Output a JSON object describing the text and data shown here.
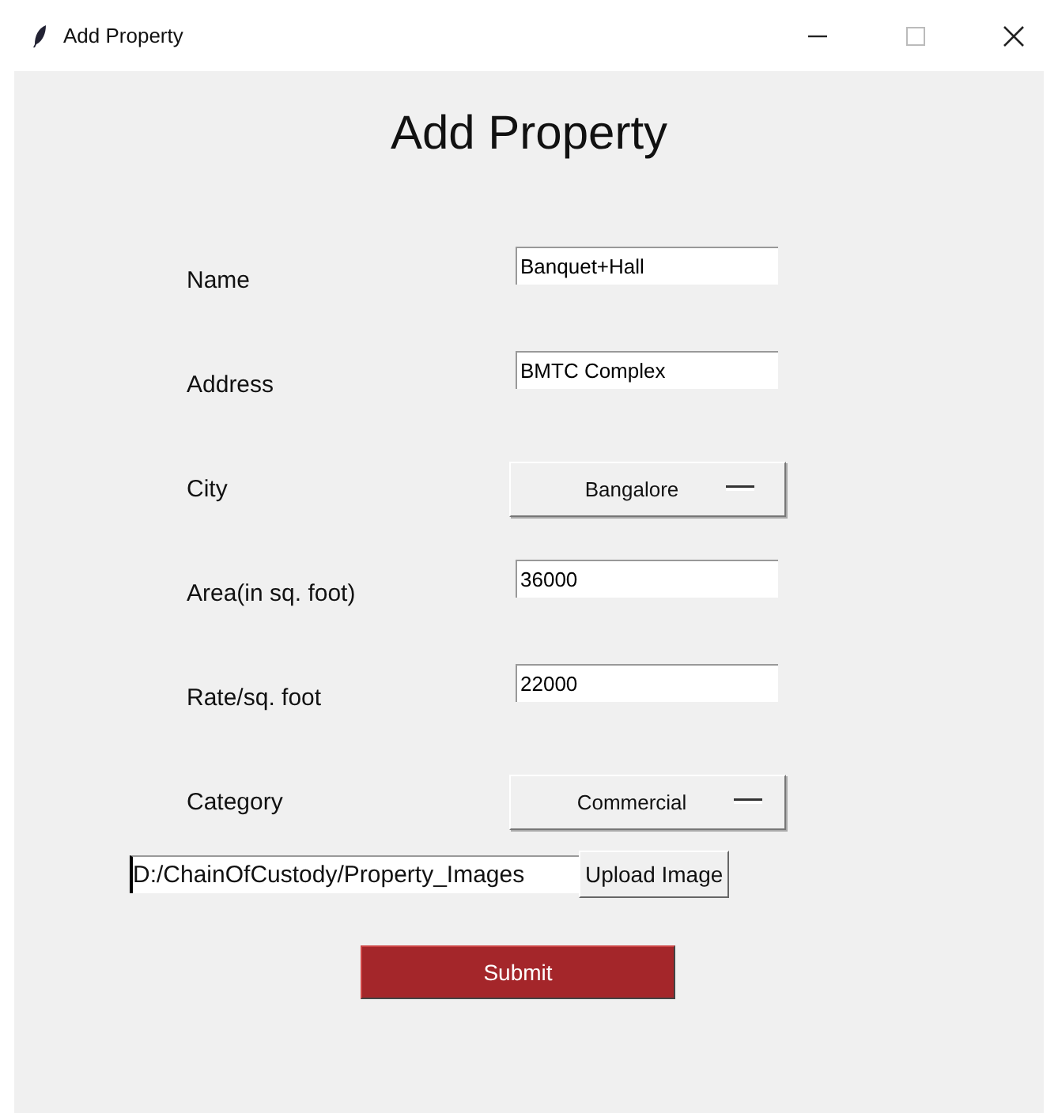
{
  "window": {
    "title": "Add Property"
  },
  "heading": "Add Property",
  "fields": [
    {
      "label": "Name",
      "kind": "entry",
      "value": "Banquet+Hall"
    },
    {
      "label": "Address",
      "kind": "entry",
      "value": "BMTC Complex"
    },
    {
      "label": "City",
      "kind": "dropdown",
      "value": "Bangalore"
    },
    {
      "label": "Area(in sq. foot)",
      "kind": "entry",
      "value": "36000"
    },
    {
      "label": "Rate/sq. foot",
      "kind": "entry",
      "value": "22000"
    },
    {
      "label": "Category",
      "kind": "dropdown",
      "value": "Commercial"
    }
  ],
  "image_path": {
    "value": "D:/ChainOfCustody/Property_Images"
  },
  "upload_button": "Upload Image",
  "submit_button": "Submit"
}
